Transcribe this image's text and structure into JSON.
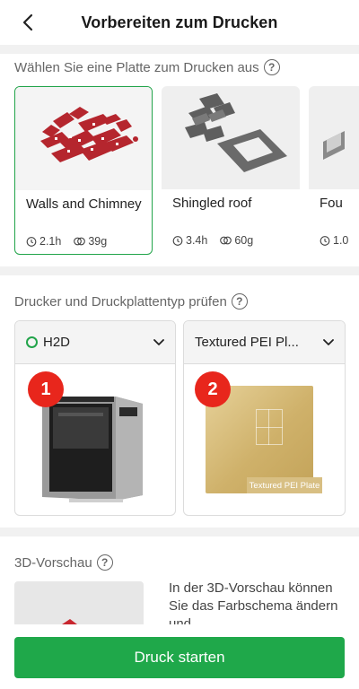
{
  "header": {
    "title": "Vorbereiten zum Drucken"
  },
  "plates_section": {
    "label": "Wählen Sie eine Platte zum Drucken aus",
    "help": "?",
    "plates": [
      {
        "name": "Walls and Chimney",
        "time": "2.1h",
        "weight": "39g",
        "selected": true
      },
      {
        "name": "Shingled roof",
        "time": "3.4h",
        "weight": "60g",
        "selected": false
      },
      {
        "name": "Fou",
        "time": "1.0",
        "weight": "",
        "selected": false
      }
    ]
  },
  "printer_section": {
    "label": "Drucker und Druckplattentyp prüfen",
    "help": "?",
    "printer": {
      "name": "H2D",
      "badge": "1"
    },
    "plate_type": {
      "name": "Textured PEI Pl...",
      "badge": "2",
      "plate_label": "Textured PEI Plate"
    }
  },
  "preview_section": {
    "label": "3D-Vorschau",
    "help": "?",
    "text": "In der 3D-Vorschau können Sie das Farbschema ändern und"
  },
  "actions": {
    "start_label": "Druck starten"
  },
  "colors": {
    "accent": "#1fa84a",
    "badge": "#e8261c",
    "model": "#b5262e"
  }
}
